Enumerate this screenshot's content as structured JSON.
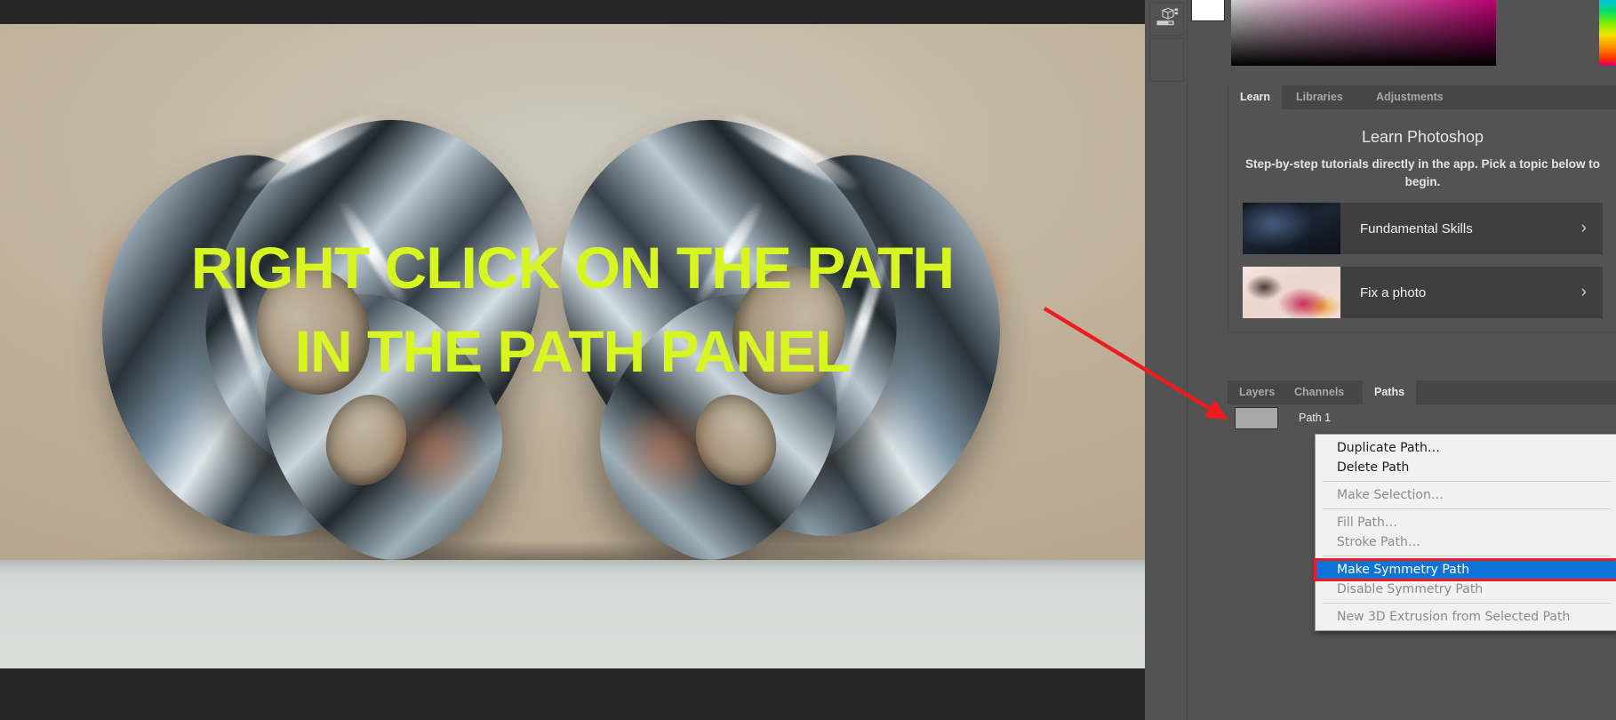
{
  "app": {
    "name": "Adobe Photoshop"
  },
  "canvas": {
    "overlay_lines": [
      "RIGHT CLICK ON THE PATH",
      "IN THE PATH PANEL"
    ],
    "overlay_color": "#d7f520",
    "annotation_arrow_color": "#ee1c1c"
  },
  "color_panel": {
    "foreground_swatch": "#ffffff",
    "field_hue": "#e6008c",
    "hue_strip_label": "hue-strip"
  },
  "tool_strip": {
    "icon": "3d-cube-icon"
  },
  "learn_panel": {
    "tabs": [
      {
        "label": "Learn",
        "active": true
      },
      {
        "label": "Libraries",
        "active": false
      },
      {
        "label": "Adjustments",
        "active": false
      }
    ],
    "title": "Learn Photoshop",
    "subtitle": "Step-by-step tutorials directly in the app. Pick a topic below to begin.",
    "cards": [
      {
        "label": "Fundamental Skills",
        "chevron": "›"
      },
      {
        "label": "Fix a photo",
        "chevron": "›"
      }
    ]
  },
  "paths_panel": {
    "tabs": [
      {
        "label": "Layers",
        "active": false
      },
      {
        "label": "Channels",
        "active": false
      },
      {
        "label": "Paths",
        "active": true
      }
    ],
    "rows": [
      {
        "name": "Path 1"
      }
    ]
  },
  "context_menu": {
    "groups": [
      [
        {
          "label": "Duplicate Path…",
          "state": "enabled"
        },
        {
          "label": "Delete Path",
          "state": "enabled"
        }
      ],
      [
        {
          "label": "Make Selection…",
          "state": "disabled"
        }
      ],
      [
        {
          "label": "Fill Path…",
          "state": "disabled"
        },
        {
          "label": "Stroke Path…",
          "state": "disabled"
        }
      ],
      [
        {
          "label": "Make Symmetry Path",
          "state": "selected"
        },
        {
          "label": "Disable Symmetry Path",
          "state": "disabled"
        }
      ],
      [
        {
          "label": "New 3D Extrusion from Selected Path",
          "state": "disabled"
        }
      ]
    ],
    "highlight_color": "#0b74d4",
    "highlight_box_color": "#ee1c1c"
  }
}
